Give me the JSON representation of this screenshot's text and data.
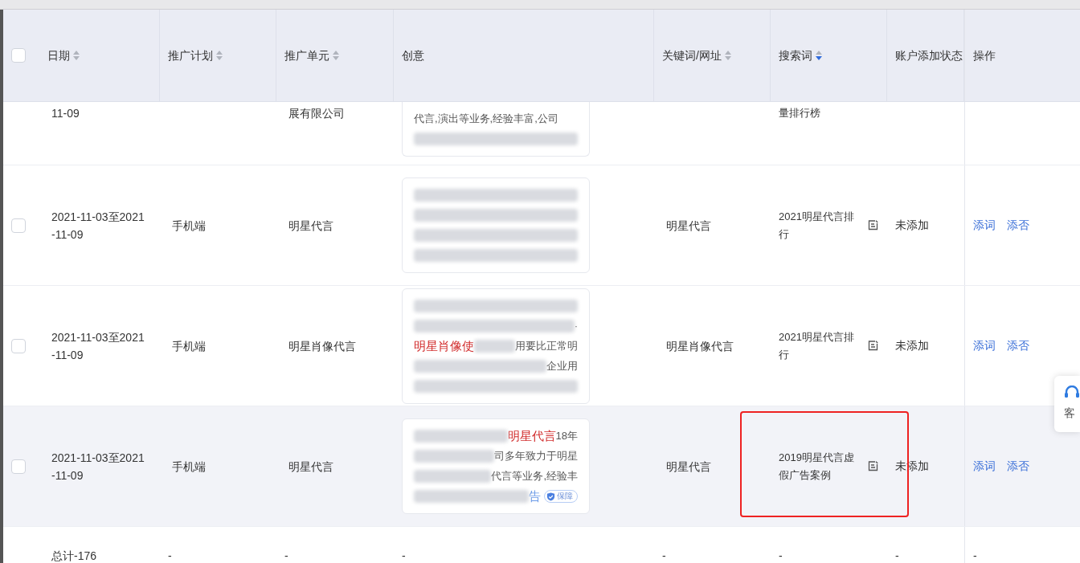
{
  "header": {
    "select_all": {
      "checked": false
    },
    "columns": [
      {
        "label": "日期",
        "sortable": true,
        "sorted_desc": false
      },
      {
        "label": "推广计划",
        "sortable": true,
        "sorted_desc": false
      },
      {
        "label": "推广单元",
        "sortable": true,
        "sorted_desc": false
      },
      {
        "label": "创意",
        "sortable": false
      },
      {
        "label": "关键词/网址",
        "sortable": true,
        "sorted_desc": false
      },
      {
        "label": "搜索词",
        "sortable": true,
        "sorted_desc": true
      },
      {
        "label": "账户添加状态",
        "sortable": false
      },
      {
        "label": "操作",
        "sortable": false
      }
    ]
  },
  "rows": [
    {
      "kind": "partial",
      "date": "11-09",
      "plan": "",
      "unit": "展有限公司",
      "creative": [
        [
          {
            "kind": "text",
            "text": "代言,演出等业务,经验丰富,公司",
            "highlight": false
          }
        ],
        [
          {
            "kind": "blur"
          }
        ]
      ],
      "keyword": "",
      "search_term": "量排行榜",
      "status": "",
      "actions": [],
      "annotated": false,
      "hovered": false
    },
    {
      "kind": "full",
      "checked": false,
      "date": "2021-11-03至2021-11-09",
      "plan": "手机端",
      "unit": "明星代言",
      "creative": [
        [
          {
            "kind": "blur"
          }
        ],
        [
          {
            "kind": "blur"
          }
        ],
        [
          {
            "kind": "blur"
          }
        ],
        [
          {
            "kind": "blur"
          }
        ]
      ],
      "keyword": "明星代言",
      "search_term": "2021明星代言排行",
      "status": "未添加",
      "actions": [
        "添词",
        "添否"
      ],
      "annotated": false,
      "hovered": false
    },
    {
      "kind": "full",
      "checked": false,
      "date": "2021-11-03至2021-11-09",
      "plan": "手机端",
      "unit": "明星肖像代言",
      "creative": [
        [
          {
            "kind": "blur"
          }
        ],
        [
          {
            "kind": "blur"
          },
          {
            "kind": "text",
            "text": "·",
            "highlight": false
          }
        ],
        [
          {
            "kind": "text",
            "text": "明星肖像使",
            "highlight": true
          },
          {
            "kind": "blur"
          },
          {
            "kind": "text",
            "text": "用要比正常明",
            "highlight": false
          }
        ],
        [
          {
            "kind": "blur"
          },
          {
            "kind": "text",
            "text": "企业用",
            "highlight": false
          }
        ],
        [
          {
            "kind": "blur"
          }
        ]
      ],
      "keyword": "明星肖像代言",
      "search_term": "2021明星代言排行",
      "status": "未添加",
      "actions": [
        "添词",
        "添否"
      ],
      "annotated": false,
      "hovered": false
    },
    {
      "kind": "full",
      "checked": false,
      "date": "2021-11-03至2021-11-09",
      "plan": "手机端",
      "unit": "明星代言",
      "creative": [
        [
          {
            "kind": "blur"
          },
          {
            "kind": "text",
            "text": "明星代言",
            "highlight": true
          },
          {
            "kind": "text",
            "text": "18年",
            "highlight": false
          }
        ],
        [
          {
            "kind": "blur"
          },
          {
            "kind": "text",
            "text": "司多年致力于明星",
            "highlight": false
          }
        ],
        [
          {
            "kind": "blur"
          },
          {
            "kind": "text",
            "text": "代言等业务,经验丰",
            "highlight": false
          }
        ],
        [
          {
            "kind": "blur"
          },
          {
            "kind": "link",
            "text": "告"
          },
          {
            "kind": "badge",
            "text": "保障"
          }
        ]
      ],
      "keyword": "明星代言",
      "search_term": "2019明星代言虚假广告案例",
      "status": "未添加",
      "actions": [
        "添词",
        "添否"
      ],
      "annotated": true,
      "hovered": true
    }
  ],
  "total_row": {
    "label": "总计-176",
    "cells": [
      "-",
      "-",
      "-",
      "-",
      "-",
      "-",
      "-"
    ]
  },
  "service_widget": {
    "label": "客"
  }
}
